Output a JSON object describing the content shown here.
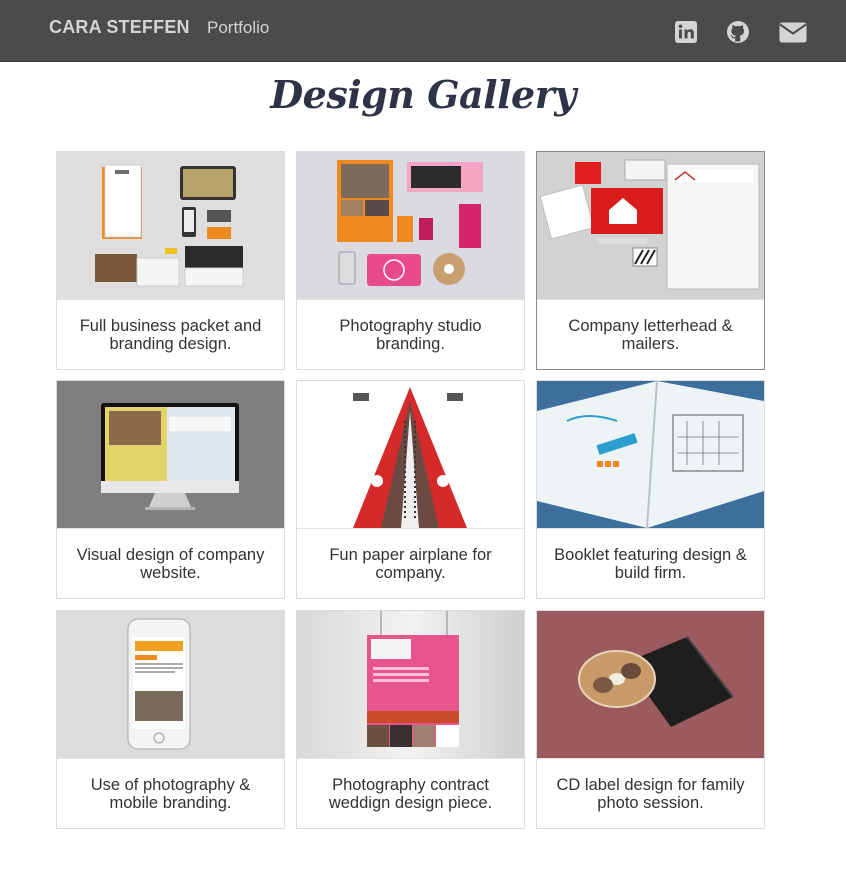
{
  "navbar": {
    "brand": "CARA STEFFEN",
    "link": "Portfolio",
    "icons": [
      "linkedin-icon",
      "github-icon",
      "mail-icon"
    ]
  },
  "page": {
    "title": "Design Gallery"
  },
  "gallery": [
    {
      "caption": "Full business packet and branding design."
    },
    {
      "caption": "Photography studio branding."
    },
    {
      "caption": "Company letterhead & mailers."
    },
    {
      "caption": "Visual design of company website."
    },
    {
      "caption": "Fun paper airplane for company."
    },
    {
      "caption": "Booklet featuring design & build firm."
    },
    {
      "caption": "Use of photography & mobile branding."
    },
    {
      "caption": "Photography contract weddign design piece."
    },
    {
      "caption": "CD label design for family photo session."
    }
  ],
  "colors": {
    "navbar": "#4a4b4d",
    "nav_text": "#d4d4d4",
    "title": "#2e3347"
  }
}
